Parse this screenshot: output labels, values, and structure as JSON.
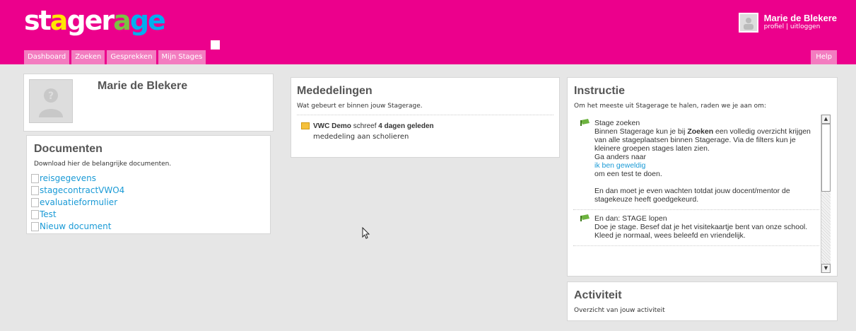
{
  "brand": {
    "logo_letters": [
      "st",
      "a",
      "ger",
      "a",
      "ge"
    ]
  },
  "nav": {
    "tabs": [
      "Dashboard",
      "Zoeken",
      "Gesprekken",
      "Mijn Stages"
    ],
    "help": "Help"
  },
  "user": {
    "name": "Marie de Blekere",
    "profile_link": "profiel",
    "separator": "|",
    "logout_link": "uitloggen"
  },
  "profile": {
    "name": "Marie de Blekere"
  },
  "documents": {
    "title": "Documenten",
    "subtitle": "Download hier de belangrijke documenten.",
    "items": [
      "reisgegevens",
      "stagecontractVWO4",
      "evaluatieformulier",
      "Test",
      "Nieuw document"
    ]
  },
  "announcements": {
    "title": "Mededelingen",
    "subtitle": "Wat gebeurt er binnen jouw Stagerage.",
    "item": {
      "author": "VWC Demo",
      "verb": "schreef",
      "when": "4 dagen geleden",
      "text": "mededeling aan scholieren"
    }
  },
  "instructions": {
    "title": "Instructie",
    "subtitle": "Om het meeste uit Stagerage te halen, raden we je aan om:",
    "step1": {
      "heading": "Stage zoeken",
      "text_a": "Binnen Stagerage kun je bij",
      "bold": "Zoeken",
      "text_b": "een volledig overzicht krijgen van alle stageplaatsen binnen Stagerage. Via de filters kun je kleinere groepen stages laten zien.",
      "line_else": "Ga anders naar",
      "link": "ik ben geweldig",
      "line_test": "om een test te doen.",
      "line_wait": "En dan moet je even wachten totdat jouw docent/mentor de stagekeuze heeft goedgekeurd."
    },
    "step2": {
      "heading": "En dan: STAGE lopen",
      "text": "Doe je stage. Besef dat je het visitekaartje bent van onze school. Kleed je normaal, wees beleefd en vriendelijk."
    }
  },
  "activity": {
    "title": "Activiteit",
    "subtitle": "Overzicht van jouw activiteit"
  },
  "colors": {
    "brand": "#ec008c",
    "tab": "#f37cc0",
    "link": "#1a9ad6",
    "background": "#e6e6e6"
  },
  "icons": [
    "user-avatar-icon",
    "document-icon",
    "envelope-icon",
    "flag-icon",
    "mouse-cursor-icon"
  ]
}
